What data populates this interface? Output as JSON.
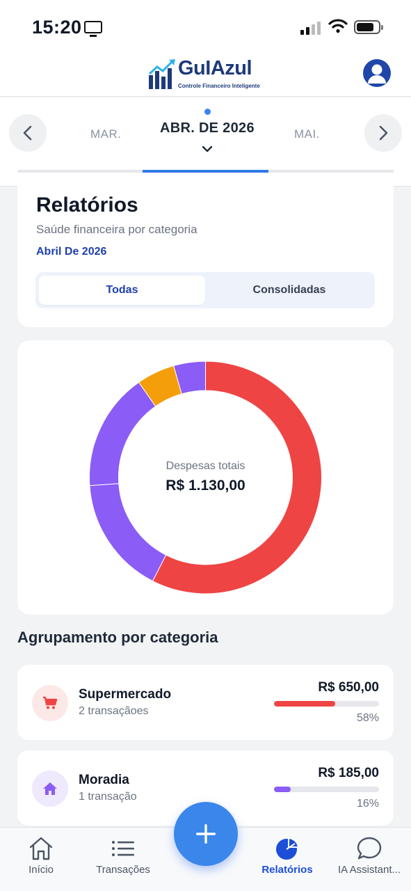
{
  "status_bar": {
    "time": "15:20"
  },
  "app": {
    "name": "GuIAzul",
    "tagline": "Controle Financeiro Inteligente"
  },
  "month_selector": {
    "previous": "MAR.",
    "current": "ABR. DE 2026",
    "next": "MAI.",
    "progress_fraction": 0.333
  },
  "report": {
    "title": "Relatórios",
    "subtitle": "Saúde financeira por categoria",
    "period": "Abril De 2026",
    "filters": [
      {
        "label": "Todas",
        "active": true
      },
      {
        "label": "Consolidadas",
        "active": false
      }
    ]
  },
  "chart_data": {
    "type": "pie",
    "variant": "donut",
    "center_label": "Despesas totais",
    "center_value": "R$ 1.130,00",
    "slices": [
      {
        "value": 650,
        "color": "#ef4444"
      },
      {
        "value": 185,
        "color": "#8b5cf6"
      },
      {
        "value": 185,
        "color": "#8b5cf6"
      },
      {
        "value": 60,
        "color": "#f59e0b"
      },
      {
        "value": 50,
        "color": "#8b5cf6"
      }
    ]
  },
  "categories_section": {
    "title": "Agrupamento por categoria"
  },
  "categories": [
    {
      "name": "Supermercado",
      "count": "2 transaçãoes",
      "amount": "R$ 650,00",
      "percent_label": "58%",
      "percent": 0.58,
      "icon": "cart-icon",
      "color": "#ef4444",
      "icon_bg": "#fde8e8"
    },
    {
      "name": "Moradia",
      "count": "1 transação",
      "amount": "R$ 185,00",
      "percent_label": "16%",
      "percent": 0.16,
      "icon": "home-icon",
      "color": "#8b5cf6",
      "icon_bg": "#efe9fd"
    }
  ],
  "bottom_nav": {
    "items": [
      {
        "label": "Início",
        "icon": "home-icon",
        "active": false
      },
      {
        "label": "Transações",
        "icon": "list-icon",
        "active": false
      },
      {
        "label": "Relatórios",
        "icon": "pie-chart-icon",
        "active": true
      },
      {
        "label": "IA Assistant...",
        "icon": "chat-bubble-icon",
        "active": false
      }
    ],
    "fab_icon": "plus-icon"
  },
  "colors": {
    "accent": "#3a86ea",
    "brand": "#1e3a7b",
    "active_nav": "#1d4ed8"
  }
}
